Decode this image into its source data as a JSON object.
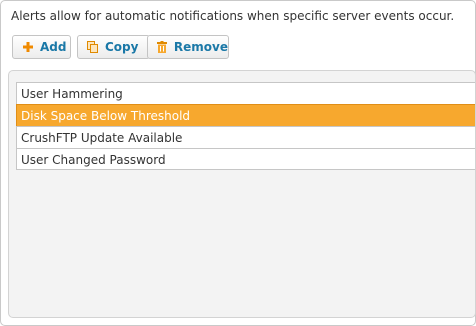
{
  "description": "Alerts allow for automatic notifications when specific server events occur.",
  "toolbar": {
    "add": {
      "label": "Add",
      "icon": "plus-icon"
    },
    "copy": {
      "label": "Copy",
      "icon": "copy-icon"
    },
    "remove": {
      "label": "Remove",
      "icon": "trash-icon"
    }
  },
  "alerts": {
    "items": [
      {
        "label": "User Hammering",
        "selected": false
      },
      {
        "label": "Disk Space Below Threshold",
        "selected": true
      },
      {
        "label": "CrushFTP Update Available",
        "selected": false
      },
      {
        "label": "User Changed Password",
        "selected": false
      }
    ]
  },
  "colors": {
    "accent": "#1a78a7",
    "selected": "#f7a82e",
    "icon": "#f08a00"
  }
}
